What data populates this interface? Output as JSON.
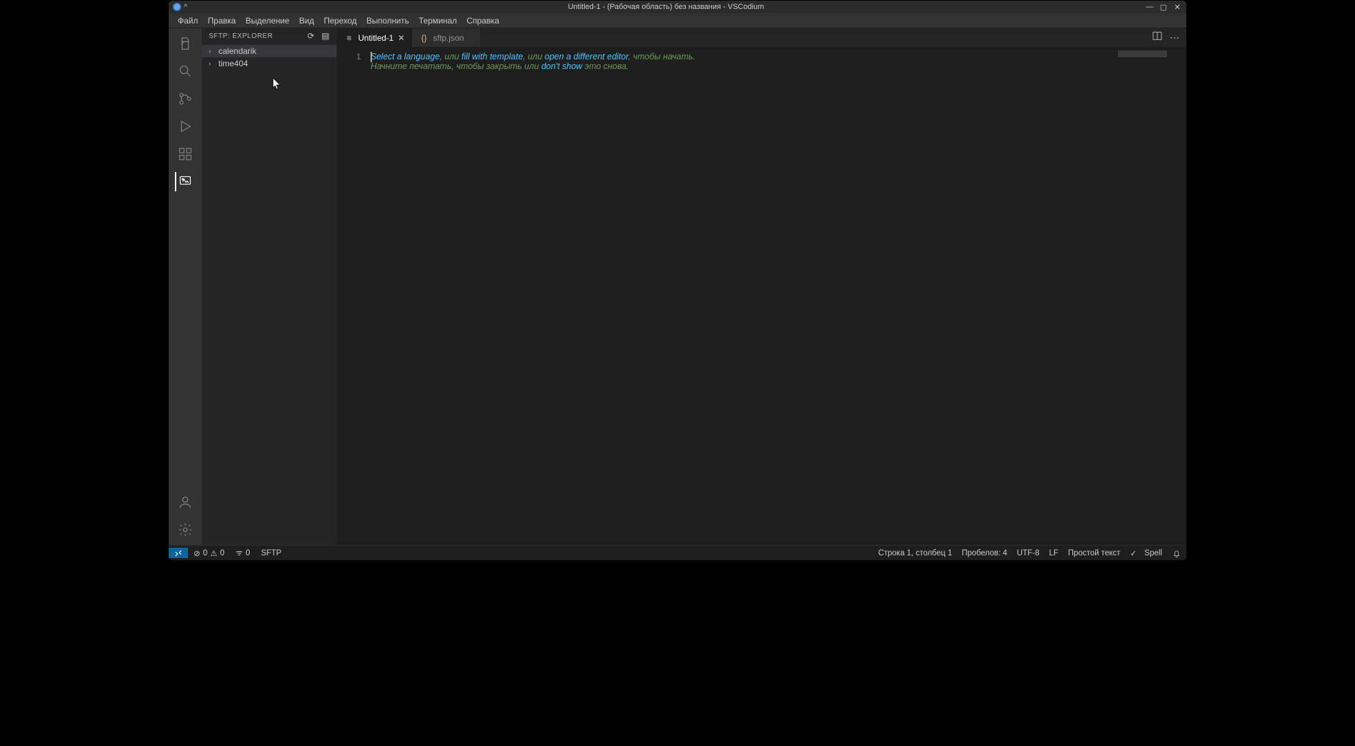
{
  "os_titlebar": {
    "title": "Untitled-1 - (Рабочая область) без названия - VSCodium"
  },
  "menubar": [
    "Файл",
    "Правка",
    "Выделение",
    "Вид",
    "Переход",
    "Выполнить",
    "Терминал",
    "Справка"
  ],
  "sidebar": {
    "title": "SFTP: EXPLORER",
    "items": [
      {
        "label": "calendarik",
        "selected": true
      },
      {
        "label": "time404",
        "selected": false
      }
    ]
  },
  "tabs": {
    "items": [
      {
        "label": "Untitled-1",
        "icon": "text-file",
        "active": true,
        "closeable": true
      },
      {
        "label": "sftp.json",
        "icon": "json-braces",
        "active": false,
        "closeable": false
      }
    ]
  },
  "editor": {
    "line_number": "1",
    "placeholder": {
      "l1_link1": "Select a language",
      "l1_sep1": ", или ",
      "l1_link2": "fill with template",
      "l1_sep2": ", или ",
      "l1_link3": "open a different editor",
      "l1_tail": ", чтобы начать.",
      "l2_head": "Начните печатать, чтобы закрыть или ",
      "l2_link": "don't show",
      "l2_tail": " это снова."
    }
  },
  "statusbar": {
    "errors": "0",
    "warnings": "0",
    "ports": "0",
    "sftp": "SFTP",
    "cursor": "Строка 1, столбец 1",
    "spaces": "Пробелов: 4",
    "encoding": "UTF-8",
    "eol": "LF",
    "lang": "Простой текст",
    "spell": "Spell"
  }
}
